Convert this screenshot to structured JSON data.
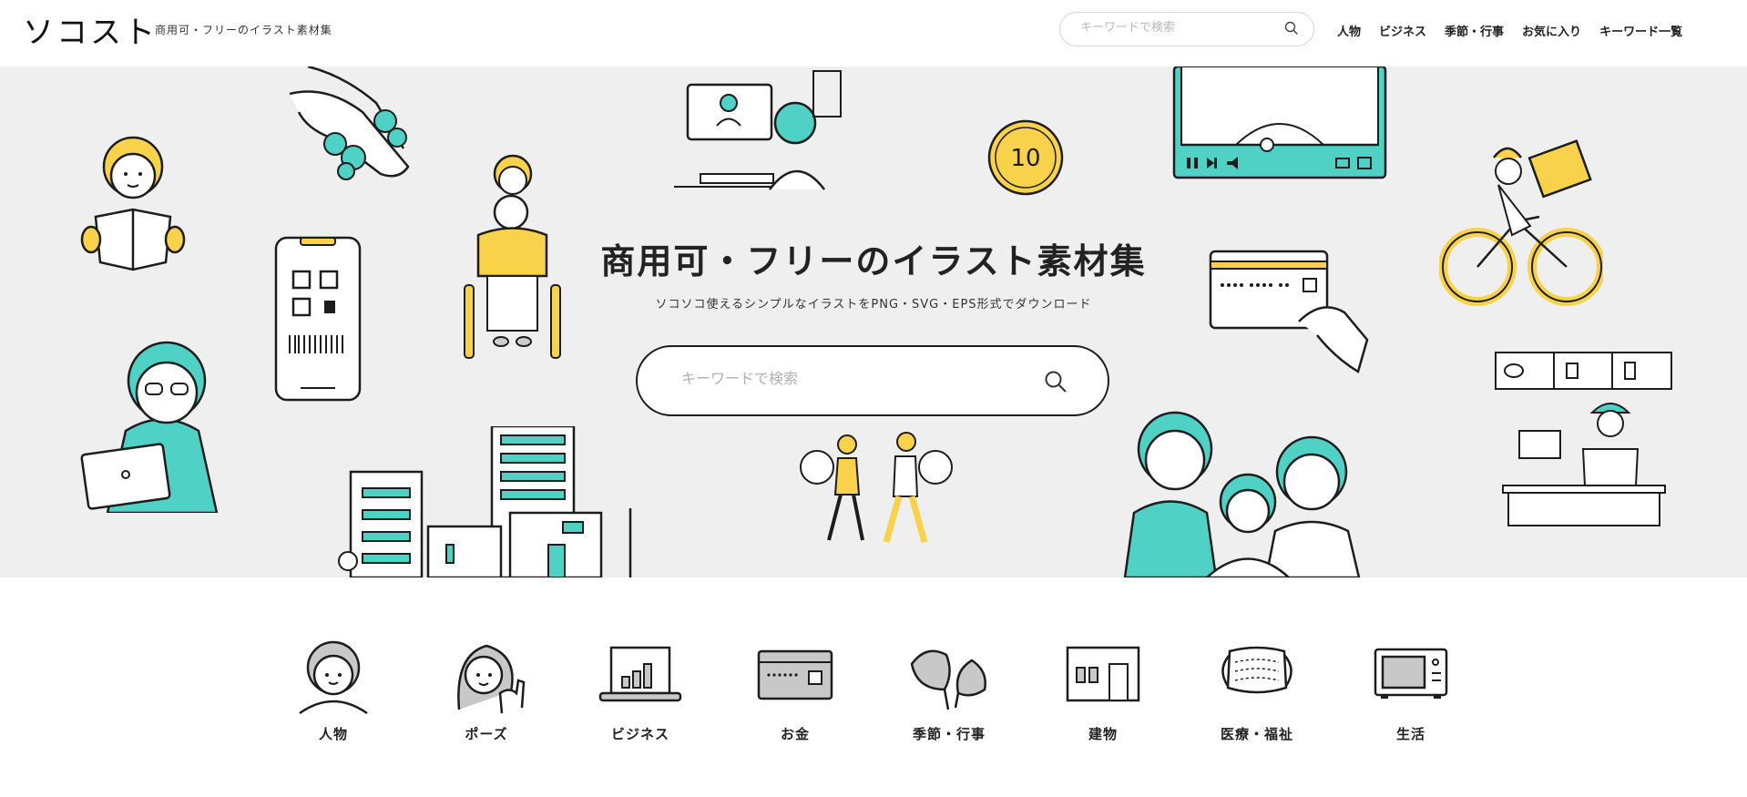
{
  "header": {
    "logo": "ソコスト",
    "tagline": "商用可・フリーのイラスト素材集",
    "search_placeholder": "キーワードで検索",
    "nav": [
      "人物",
      "ビジネス",
      "季節・行事",
      "お気に入り",
      "キーワード一覧"
    ]
  },
  "hero": {
    "title": "商用可・フリーのイラスト素材集",
    "subtitle": "ソコソコ使えるシンプルなイラストをPNG・SVG・EPS形式でダウンロード",
    "search_placeholder": "キーワードで検索",
    "coin_text": "10"
  },
  "categories": [
    {
      "label": "人物",
      "icon": "person-icon"
    },
    {
      "label": "ポーズ",
      "icon": "pose-icon"
    },
    {
      "label": "ビジネス",
      "icon": "business-icon"
    },
    {
      "label": "お金",
      "icon": "money-icon"
    },
    {
      "label": "季節・行事",
      "icon": "ginkgo-leaf-icon"
    },
    {
      "label": "建物",
      "icon": "building-icon"
    },
    {
      "label": "医療・福祉",
      "icon": "mask-icon"
    },
    {
      "label": "生活",
      "icon": "microwave-icon"
    }
  ],
  "colors": {
    "teal": "#4fd1c5",
    "yellow": "#f7d24a",
    "hero_bg": "#efefef",
    "line": "#1d1d1d"
  }
}
